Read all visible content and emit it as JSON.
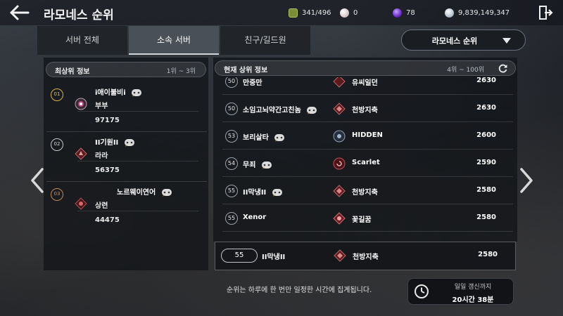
{
  "header": {
    "title": "라모네스 순위",
    "resources": [
      {
        "icon": "inventory-icon",
        "value": "341/496"
      },
      {
        "icon": "pearl-icon",
        "value": "0"
      },
      {
        "icon": "purple-gem-icon",
        "value": "78"
      },
      {
        "icon": "silver-coin-icon",
        "value": "9,839,149,347"
      }
    ]
  },
  "tabs": [
    {
      "label": "서버 전체",
      "active": false
    },
    {
      "label": "소속 서버",
      "active": true
    },
    {
      "label": "친구/길드원",
      "active": false
    }
  ],
  "dropdown": {
    "selected": "라모네스 순위"
  },
  "top_panel": {
    "title": "최상위 정보",
    "range": "1위 ~ 3위",
    "entries": [
      {
        "rank": "01",
        "name": "i애이불비i",
        "guild": "부부",
        "score": "97175"
      },
      {
        "rank": "02",
        "name": "II기원II",
        "guild": "라라",
        "score": "56375"
      },
      {
        "rank": "03",
        "name": "노르웨이연어",
        "guild": "상련",
        "score": "44475"
      }
    ]
  },
  "list_panel": {
    "title": "현재 상위 정보",
    "range": "4위 ~ 100위",
    "rows": [
      {
        "level": "50",
        "name": "만중만",
        "guild": "유씨일던",
        "score": "2630"
      },
      {
        "level": "50",
        "name": "소임고뇌약간고친놈",
        "guild": "천방지축",
        "score": "2630"
      },
      {
        "level": "53",
        "name": "보리살타",
        "guild": "HIDDEN",
        "score": "2600"
      },
      {
        "level": "54",
        "name": "무죄",
        "guild": "Scarlet",
        "score": "2590"
      },
      {
        "level": "55",
        "name": "II막냉II",
        "guild": "천방지축",
        "score": "2580"
      },
      {
        "level": "55",
        "name": "Xenor",
        "guild": "꽃길꿈",
        "score": "2580"
      }
    ]
  },
  "my_rank": {
    "level": "55",
    "name": "II막냉II",
    "guild": "천방지축",
    "score": "2580"
  },
  "footer": {
    "notice": "순위는 하루에 한 번만 일정한 시간에 집계됩니다.",
    "refresh_label": "일일 갱신까지",
    "refresh_time": "20시간 38분"
  },
  "colors": {
    "gold": "#d9b24a",
    "guild_red": "#8a1f24",
    "accent_purple": "#7a3bd1"
  }
}
